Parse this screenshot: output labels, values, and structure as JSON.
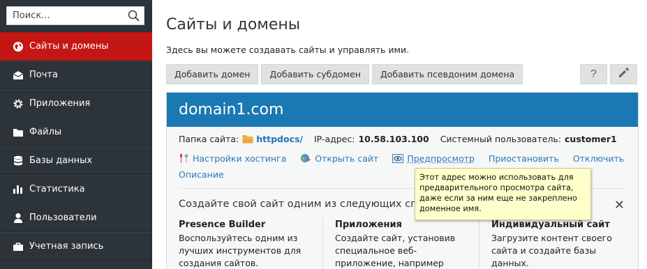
{
  "search": {
    "placeholder": "Поиск..."
  },
  "sidebar": {
    "items": [
      {
        "label": "Сайты и домены",
        "icon": "globe-icon"
      },
      {
        "label": "Почта",
        "icon": "mail-icon"
      },
      {
        "label": "Приложения",
        "icon": "gear-icon"
      },
      {
        "label": "Файлы",
        "icon": "folder-icon"
      },
      {
        "label": "Базы данных",
        "icon": "database-icon"
      },
      {
        "label": "Статистика",
        "icon": "bar-chart-icon"
      },
      {
        "label": "Пользователи",
        "icon": "user-icon"
      },
      {
        "label": "Учетная запись",
        "icon": "briefcase-icon"
      }
    ]
  },
  "page": {
    "title": "Сайты и домены",
    "description": "Здесь вы можете создавать сайты и управлять ими."
  },
  "toolbar": {
    "add_domain": "Добавить домен",
    "add_subdomain": "Добавить субдомен",
    "add_alias": "Добавить псевдоним домена",
    "help": "?",
    "settings_icon": "wrench-icon"
  },
  "domain": {
    "name": "domain1.com",
    "folder_label": "Папка сайта:",
    "folder": "httpdocs/",
    "ip_label": "IP-адрес:",
    "ip": "10.58.103.100",
    "user_label": "Системный пользователь:",
    "user": "customer1",
    "actions": {
      "hosting": "Настройки хостинга",
      "open": "Открыть сайт",
      "preview": "Предпросмотр",
      "suspend": "Приостановить",
      "disable": "Отключить",
      "description": "Описание"
    }
  },
  "create": {
    "title": "Создайте свой сайт одним из следующих спос",
    "columns": [
      {
        "title": "Presence Builder",
        "lines": [
          "Воспользуйтесь одним из",
          "лучших инструментов для",
          "создания сайтов."
        ]
      },
      {
        "title": "Приложения",
        "lines": [
          "Создайте сайт, установив",
          "специальное веб-",
          "приложение, например"
        ]
      },
      {
        "title": "Индивидуальный сайт",
        "lines": [
          "Загрузите контент своего",
          "сайта и создайте базы",
          "данных."
        ]
      }
    ]
  },
  "tooltip": {
    "lines": [
      "Этот адрес можно использовать для",
      "предварительного просмотра сайта,",
      "даже если за ним еще не закреплено",
      "доменное имя."
    ]
  },
  "colors": {
    "sidebar_bg": "#2c3339",
    "active_nav": "#c41714",
    "domain_header": "#1a79b2",
    "link": "#2b77b8",
    "tooltip_bg": "#ffffcc"
  }
}
